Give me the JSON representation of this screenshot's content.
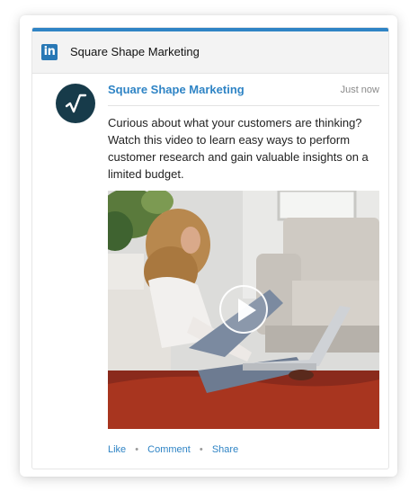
{
  "header": {
    "logo_text": "in",
    "title": "Square Shape Marketing"
  },
  "post": {
    "author": "Square Shape Marketing",
    "timestamp": "Just now",
    "text": "Curious about what your customers are thinking? Watch this video to learn easy ways to perform customer research and gain valuable insights on a limited budget.",
    "media": {
      "type": "video",
      "play_icon": "play-icon"
    }
  },
  "actions": {
    "like": "Like",
    "comment": "Comment",
    "share": "Share",
    "separator": "•"
  },
  "colors": {
    "accent": "#2f84c5",
    "avatar_bg": "#173b4a",
    "header_bg": "#f3f3f3"
  }
}
